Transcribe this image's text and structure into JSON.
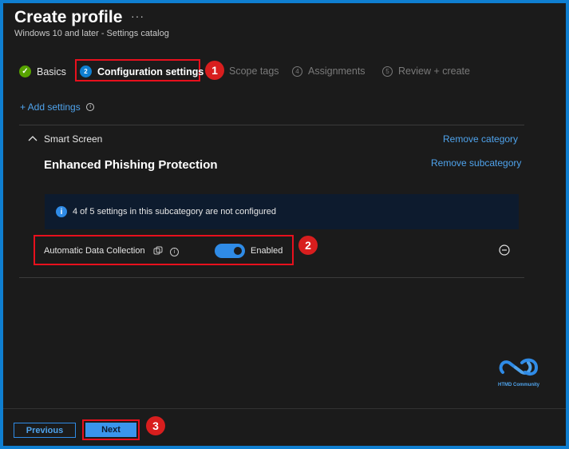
{
  "header": {
    "title": "Create profile",
    "more_label": "···",
    "subtitle": "Windows 10 and later - Settings catalog"
  },
  "steps": [
    {
      "number": "✓",
      "label": "Basics",
      "state": "completed"
    },
    {
      "number": "2",
      "label": "Configuration settings",
      "state": "active"
    },
    {
      "number": "3",
      "label": "Scope tags",
      "state": "pending"
    },
    {
      "number": "4",
      "label": "Assignments",
      "state": "pending"
    },
    {
      "number": "5",
      "label": "Review + create",
      "state": "pending"
    }
  ],
  "add_settings": {
    "label": "+ Add settings",
    "info_icon": "info-icon"
  },
  "category": {
    "name": "Smart Screen",
    "remove_category_label": "Remove category",
    "subcategory_name": "Enhanced Phishing Protection",
    "remove_subcategory_label": "Remove subcategory",
    "info_banner": "4 of 5 settings in this subcategory are not configured"
  },
  "setting": {
    "name": "Automatic Data Collection",
    "toggle_value": "Enabled",
    "toggle_on": true
  },
  "annotations": [
    "1",
    "2",
    "3"
  ],
  "watermark": {
    "text": "HTMD Community"
  },
  "footer": {
    "previous_label": "Previous",
    "next_label": "Next"
  },
  "colors": {
    "accent": "#2f8be6",
    "highlight": "#e8101d",
    "success": "#57a300",
    "background": "#1b1b1b"
  }
}
